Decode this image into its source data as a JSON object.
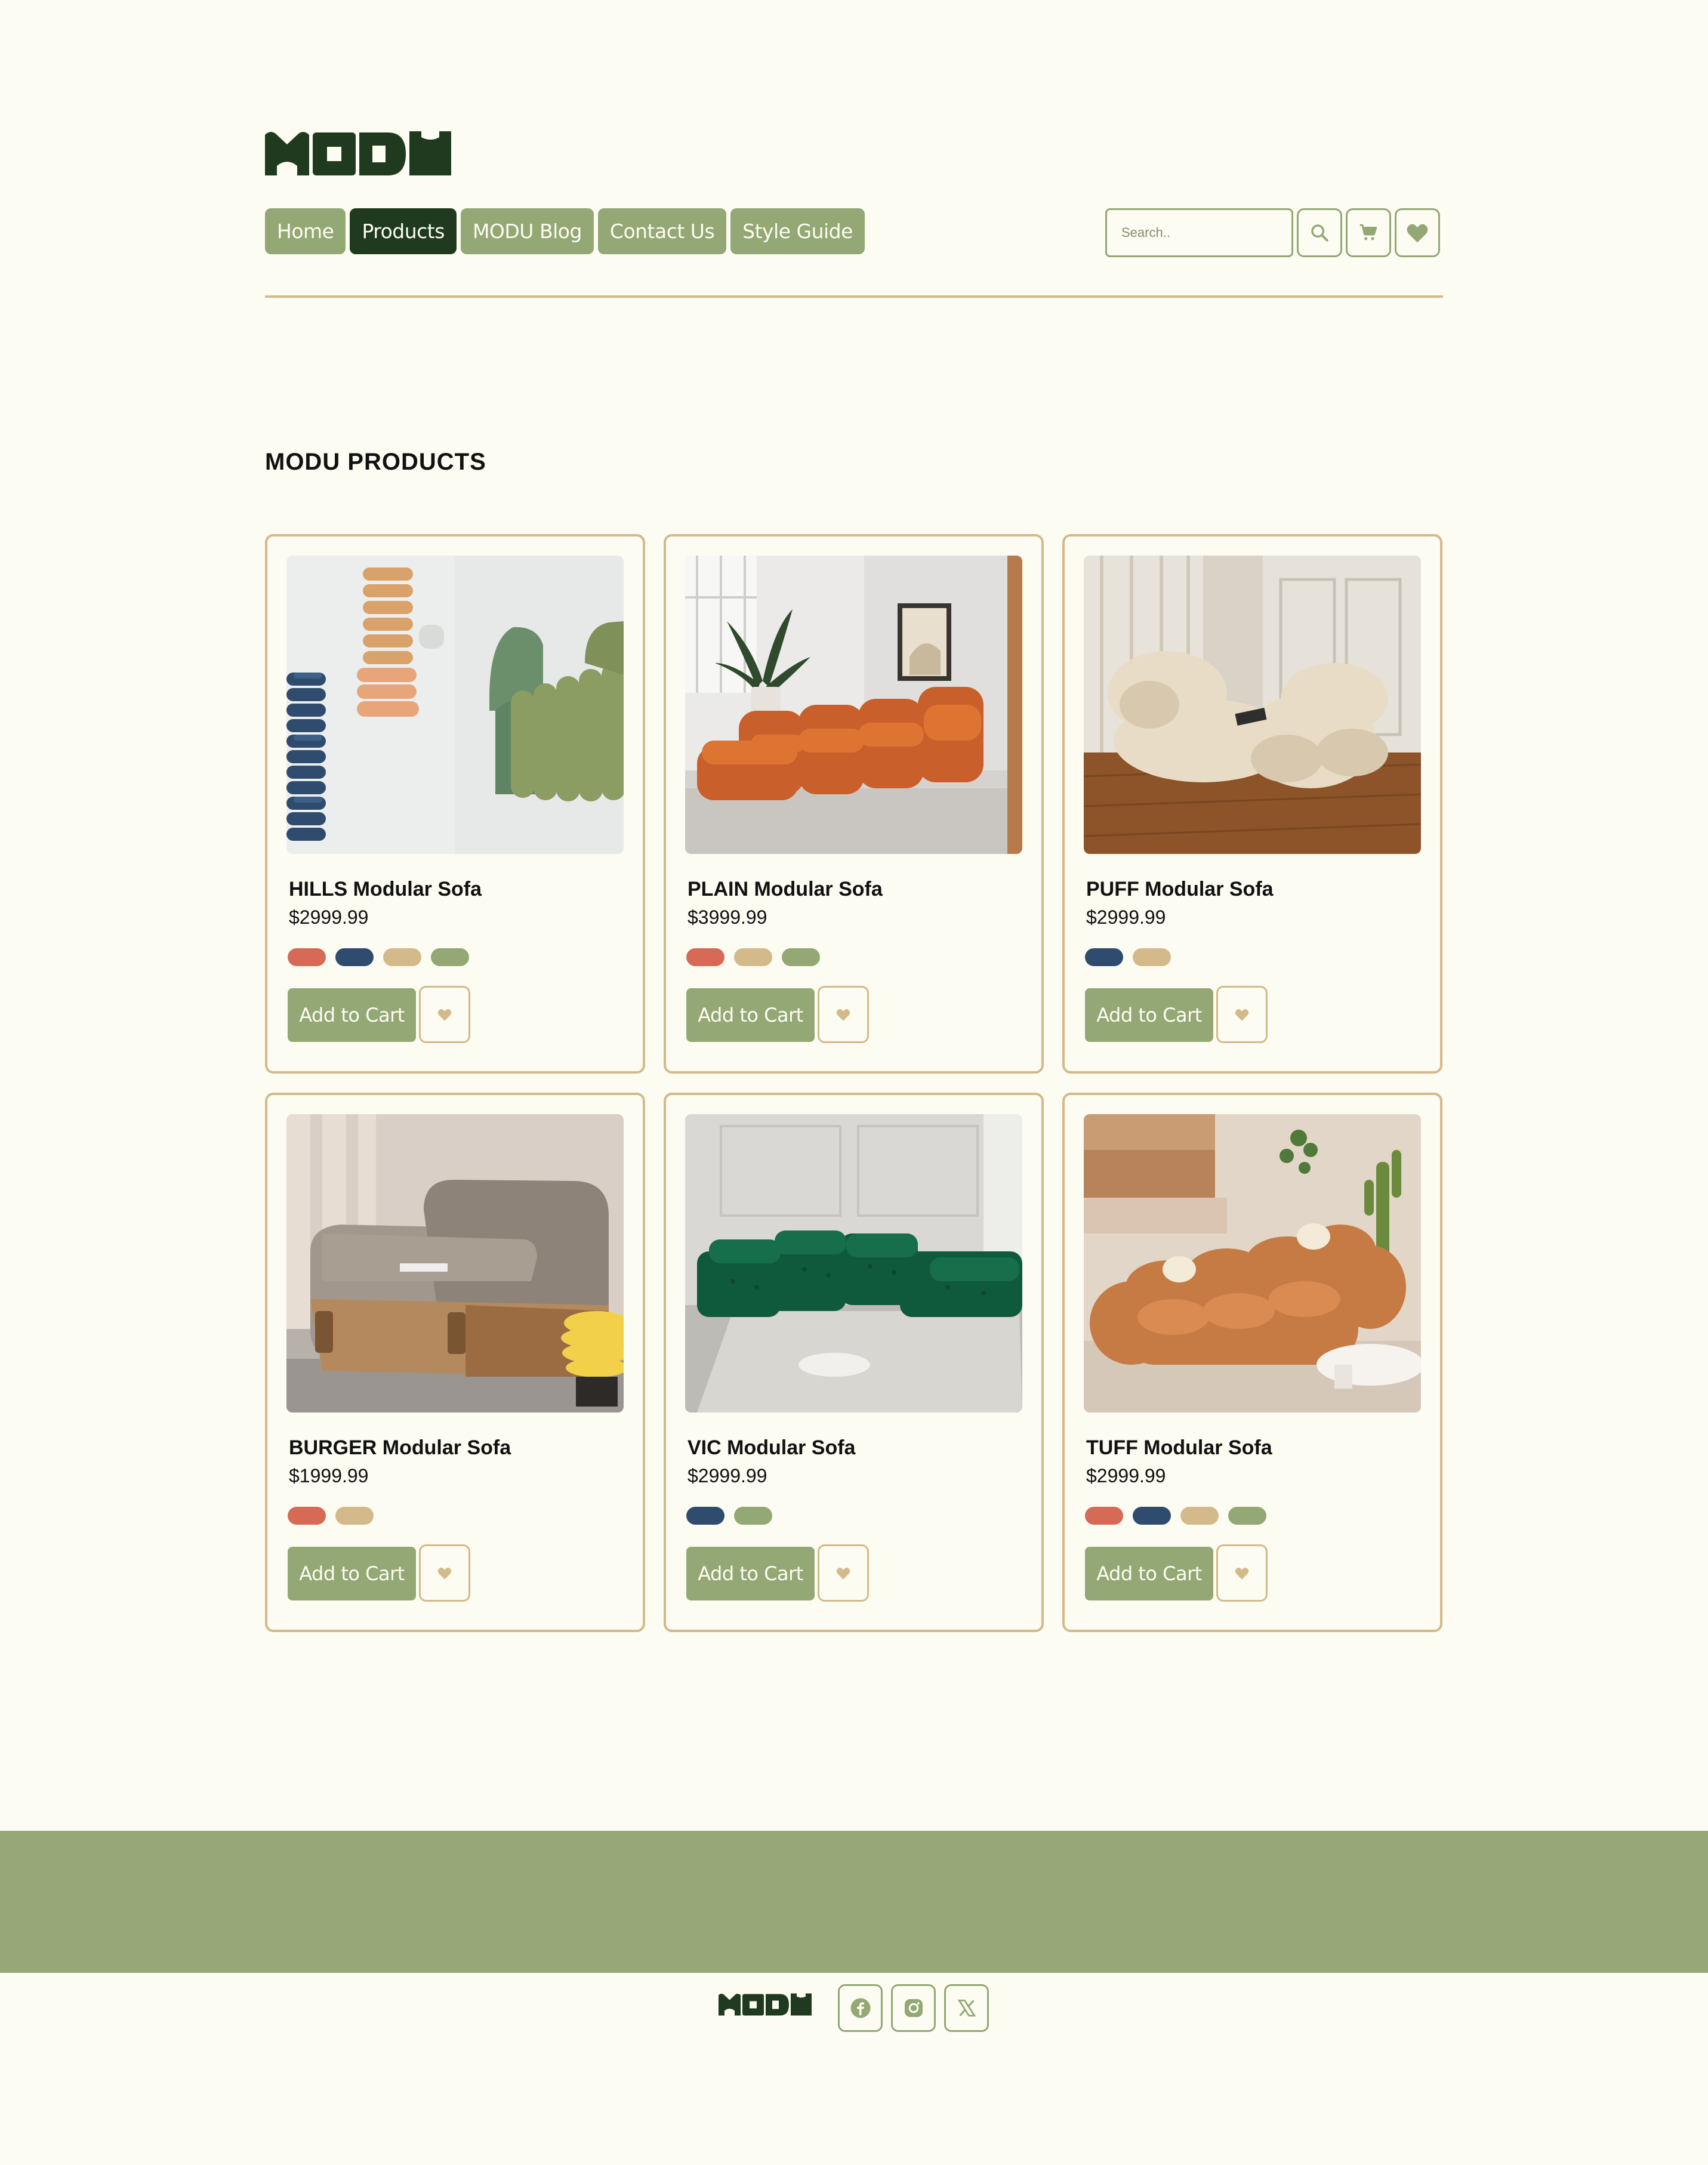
{
  "brand": {
    "logo_text": "MODU",
    "color": "#1f3a1f"
  },
  "nav": {
    "items": [
      {
        "label": "Home",
        "active": false
      },
      {
        "label": "Products",
        "active": true
      },
      {
        "label": "MODU Blog",
        "active": false
      },
      {
        "label": "Contact Us",
        "active": false
      },
      {
        "label": "Style Guide",
        "active": false
      }
    ]
  },
  "search": {
    "placeholder": "Search.."
  },
  "icons": {
    "search": "search-icon",
    "cart": "cart-icon",
    "wishlist": "heart-icon"
  },
  "section": {
    "title": "MODU PRODUCTS"
  },
  "colors": {
    "accent_green": "#93a874",
    "dark_green": "#1f3a1f",
    "tan": "#d4b98a",
    "background": "#fdfcf2",
    "swatch_red": "#d66a56",
    "swatch_navy": "#2f4c6e",
    "swatch_tan": "#d4b98a",
    "swatch_green": "#93a874"
  },
  "products": [
    {
      "name": "HILLS Modular Sofa",
      "price": "$2999.99",
      "swatches": [
        "#d66a56",
        "#2f4c6e",
        "#d4b98a",
        "#93a874"
      ],
      "add_label": "Add to Cart"
    },
    {
      "name": "PLAIN Modular Sofa",
      "price": "$3999.99",
      "swatches": [
        "#d66a56",
        "#d4b98a",
        "#93a874"
      ],
      "add_label": "Add to Cart"
    },
    {
      "name": "PUFF Modular Sofa",
      "price": "$2999.99",
      "swatches": [
        "#2f4c6e",
        "#d4b98a"
      ],
      "add_label": "Add to Cart"
    },
    {
      "name": "BURGER Modular Sofa",
      "price": "$1999.99",
      "swatches": [
        "#d66a56",
        "#d4b98a"
      ],
      "add_label": "Add to Cart"
    },
    {
      "name": "VIC Modular Sofa",
      "price": "$2999.99",
      "swatches": [
        "#2f4c6e",
        "#93a874"
      ],
      "add_label": "Add to Cart"
    },
    {
      "name": "TUFF Modular Sofa",
      "price": "$2999.99",
      "swatches": [
        "#d66a56",
        "#2f4c6e",
        "#d4b98a",
        "#93a874"
      ],
      "add_label": "Add to Cart"
    }
  ],
  "footer": {
    "logo_text": "MODU",
    "social": [
      "facebook-icon",
      "instagram-icon",
      "x-icon"
    ]
  }
}
